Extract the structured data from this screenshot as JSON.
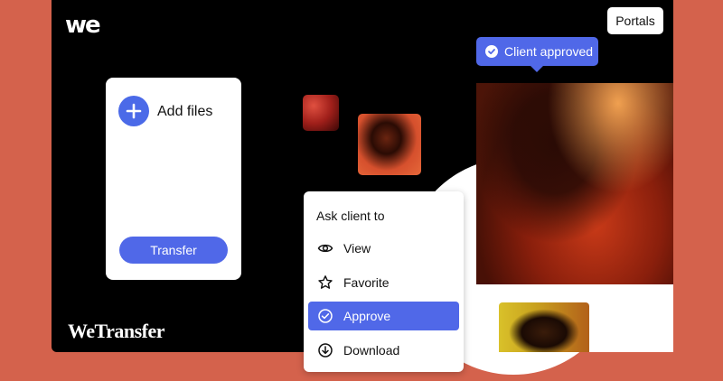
{
  "brand": {
    "logo_mark": "we",
    "wordmark": "WeTransfer"
  },
  "header": {
    "portals_label": "Portals"
  },
  "upload_card": {
    "add_files_label": "Add files",
    "transfer_label": "Transfer"
  },
  "status_pill": {
    "label": "Client approved",
    "icon": "check-circle-icon"
  },
  "menu": {
    "heading": "Ask client to",
    "items": [
      {
        "label": "View",
        "icon": "eye-icon",
        "active": false
      },
      {
        "label": "Favorite",
        "icon": "star-icon",
        "active": false
      },
      {
        "label": "Approve",
        "icon": "check-circle-icon",
        "active": true
      },
      {
        "label": "Download",
        "icon": "download-icon",
        "active": false
      }
    ]
  },
  "colors": {
    "background": "#d4624c",
    "accent": "#5068e8",
    "frame": "#000000"
  }
}
